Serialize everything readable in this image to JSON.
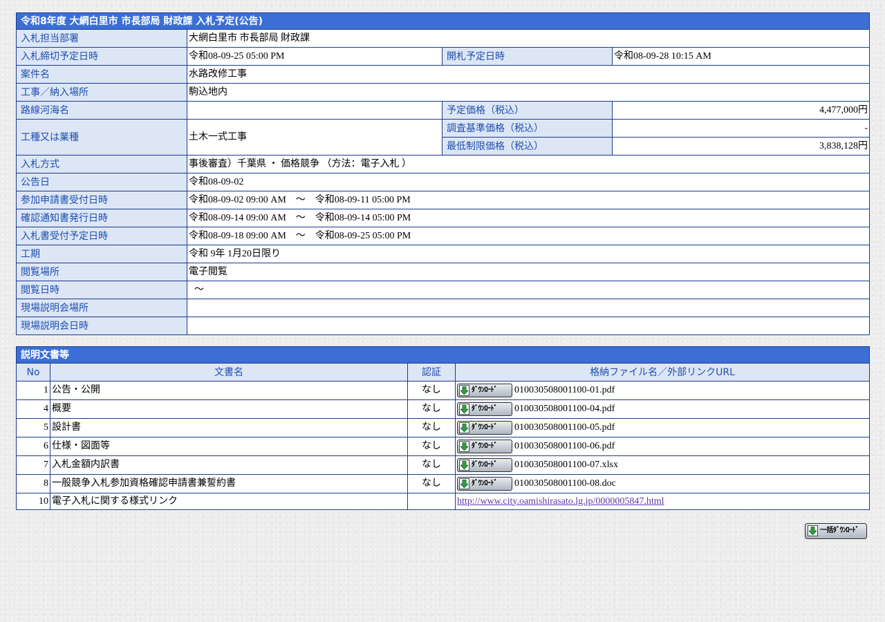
{
  "info": {
    "title": "令和8年度 大網白里市 市長部局 財政課 入札予定(公告)",
    "rows": {
      "dept": {
        "label": "入札担当部署",
        "value": "大網白里市 市長部局 財政課"
      },
      "deadline": {
        "label": "入札締切予定日時",
        "value": "令和08-09-25 05:00 PM",
        "label2": "開札予定日時",
        "value2": "令和08-09-28 10:15 AM"
      },
      "project": {
        "label": "案件名",
        "value": "水路改修工事"
      },
      "location": {
        "label": "工事／納入場所",
        "value": "駒込地内"
      },
      "route": {
        "label": "路線河海名",
        "value": "",
        "label2": "予定価格（税込）",
        "value2": "4,477,000円"
      },
      "type": {
        "label": "工種又は業種",
        "value": "土木一式工事",
        "label2a": "調査基準価格（税込）",
        "value2a": "-",
        "label2b": "最低制限価格（税込）",
        "value2b": "3,838,128円"
      },
      "method": {
        "label": "入札方式",
        "value": "事後審査）千葉県 ・ 価格競争 （方法：電子入札 ）"
      },
      "notice_date": {
        "label": "公告日",
        "value": "令和08-09-02"
      },
      "application": {
        "label": "参加申請書受付日時",
        "value": "令和08-09-02 09:00 AM　～　令和08-09-11 05:00 PM"
      },
      "confirmation": {
        "label": "確認通知書発行日時",
        "value": "令和08-09-14 09:00 AM　～　令和08-09-14 05:00 PM"
      },
      "bid_receipt": {
        "label": "入札書受付予定日時",
        "value": "令和08-09-18 09:00 AM　～　令和08-09-25 05:00 PM"
      },
      "period": {
        "label": "工期",
        "value": "令和 9年 1月20日限り"
      },
      "viewing_place": {
        "label": "閲覧場所",
        "value": "電子閲覧"
      },
      "viewing_date": {
        "label": "閲覧日時",
        "value": "～"
      },
      "briefing_place": {
        "label": "現場説明会場所",
        "value": ""
      },
      "briefing_date": {
        "label": "現場説明会日時",
        "value": ""
      }
    }
  },
  "docs": {
    "title": "説明文書等",
    "columns": {
      "no": "No",
      "name": "文書名",
      "auth": "認証",
      "file": "格納ファイル名／外部リンクURL"
    },
    "download_label": "ﾀﾞｳﾝﾛｰﾄﾞ",
    "items": [
      {
        "no": "1",
        "name": "公告・公開",
        "auth": "なし",
        "file": "010030508001100-01.pdf"
      },
      {
        "no": "4",
        "name": "概要",
        "auth": "なし",
        "file": "010030508001100-04.pdf"
      },
      {
        "no": "5",
        "name": "設計書",
        "auth": "なし",
        "file": "010030508001100-05.pdf"
      },
      {
        "no": "6",
        "name": "仕様・図面等",
        "auth": "なし",
        "file": "010030508001100-06.pdf"
      },
      {
        "no": "7",
        "name": "入札金額内訳書",
        "auth": "なし",
        "file": "010030508001100-07.xlsx"
      },
      {
        "no": "8",
        "name": "一般競争入札参加資格確認申請書兼誓約書",
        "auth": "なし",
        "file": "010030508001100-08.doc"
      }
    ],
    "link_row": {
      "no": "10",
      "name": "電子入札に関する様式リンク",
      "auth": "",
      "url": "http://www.city.oamishirasato.lg.jp/0000005847.html"
    }
  },
  "bulk_download_label": "一括ﾀﾞｳﾝﾛｰﾄﾞ",
  "colors": {
    "header_bg": "#3b6fd6",
    "label_bg": "#dce6f5",
    "label_text": "#1f4fb0",
    "border": "#1a3a8c",
    "link": "#5a3aa8"
  }
}
